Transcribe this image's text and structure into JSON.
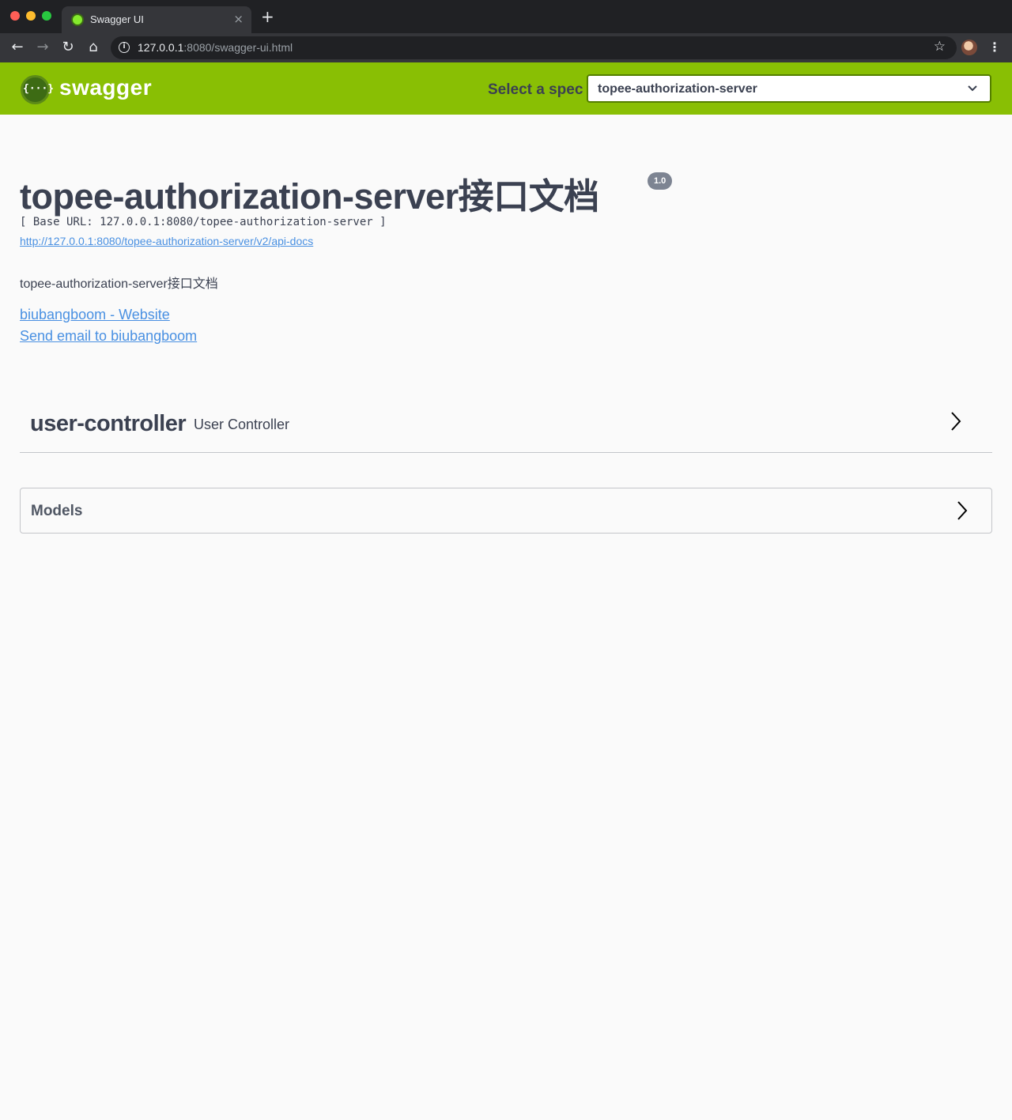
{
  "browser": {
    "tab_title": "Swagger UI",
    "tab_close": "×",
    "new_tab": "+",
    "url_host": "127.0.0.1",
    "url_rest": ":8080/swagger-ui.html",
    "icons": [
      "back-arrow-icon",
      "forward-arrow-icon",
      "reload-icon",
      "home-icon",
      "info-icon",
      "star-icon",
      "profile-avatar",
      "kebab-menu-icon"
    ]
  },
  "topbar": {
    "logo_symbol": "{···}",
    "logo_text": "swagger",
    "select_label": "Select a spec",
    "selected_spec": "topee-authorization-server",
    "background_color": "#89bf04"
  },
  "info": {
    "title": "topee-authorization-server接口文档",
    "version": "1.0",
    "base_url": "[ Base URL: 127.0.0.1:8080/topee-authorization-server ]",
    "spec_url": "http://127.0.0.1:8080/topee-authorization-server/v2/api-docs",
    "description": "topee-authorization-server接口文档",
    "contact_website": "biubangboom - Website",
    "contact_email": "Send email to biubangboom",
    "link_color": "#4990e2"
  },
  "tags": [
    {
      "name": "user-controller",
      "description": "User Controller"
    }
  ],
  "models": {
    "title": "Models"
  }
}
